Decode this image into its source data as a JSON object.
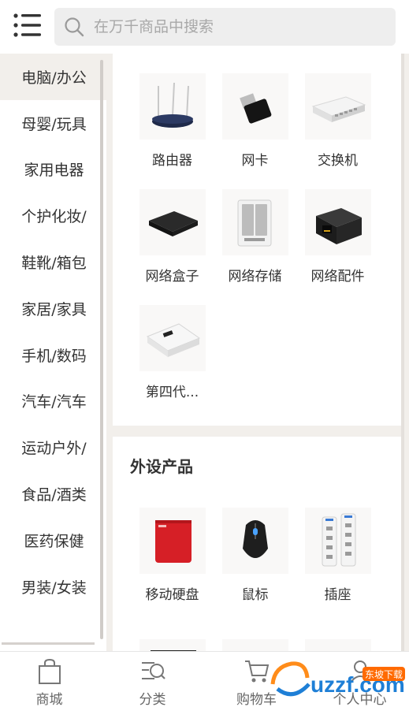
{
  "header": {
    "search": {
      "placeholder": "在万千商品中搜索",
      "value": ""
    }
  },
  "sidebar": {
    "items": [
      {
        "label": "电脑/办公",
        "active": true
      },
      {
        "label": "母婴/玩具",
        "active": false
      },
      {
        "label": "家用电器",
        "active": false
      },
      {
        "label": "个护化妆/",
        "active": false
      },
      {
        "label": "鞋靴/箱包",
        "active": false
      },
      {
        "label": "家居/家具",
        "active": false
      },
      {
        "label": "手机/数码",
        "active": false
      },
      {
        "label": "汽车/汽车",
        "active": false
      },
      {
        "label": "运动户外/",
        "active": false
      },
      {
        "label": "食品/酒类",
        "active": false
      },
      {
        "label": "医药保健",
        "active": false
      },
      {
        "label": "男装/女装",
        "active": false
      }
    ]
  },
  "main": {
    "sections": [
      {
        "title": "",
        "items": [
          {
            "label": "路由器",
            "icon": "router-image"
          },
          {
            "label": "网卡",
            "icon": "usb-wifi-adapter-image"
          },
          {
            "label": "交换机",
            "icon": "network-switch-image"
          },
          {
            "label": "网络盒子",
            "icon": "tv-box-image"
          },
          {
            "label": "网络存储",
            "icon": "nas-storage-image"
          },
          {
            "label": "网络配件",
            "icon": "ethernet-coupler-image"
          },
          {
            "label": "第四代...",
            "icon": "portable-router-image"
          }
        ]
      },
      {
        "title": "外设产品",
        "items": [
          {
            "label": "移动硬盘",
            "icon": "portable-hard-drive-image"
          },
          {
            "label": "鼠标",
            "icon": "gaming-mouse-image"
          },
          {
            "label": "插座",
            "icon": "power-strip-image"
          }
        ]
      }
    ]
  },
  "bottom_nav": {
    "items": [
      {
        "label": "商城",
        "icon": "shopping-bag-icon"
      },
      {
        "label": "分类",
        "icon": "category-search-icon"
      },
      {
        "label": "购物车",
        "icon": "cart-icon"
      },
      {
        "label": "个人中心",
        "icon": "user-icon"
      }
    ]
  },
  "watermark": {
    "brand": "uzzf.com",
    "tag": "东坡下载"
  },
  "colors": {
    "accent_bg": "#f2efeb",
    "text": "#333333",
    "placeholder": "#a8a8a8"
  }
}
